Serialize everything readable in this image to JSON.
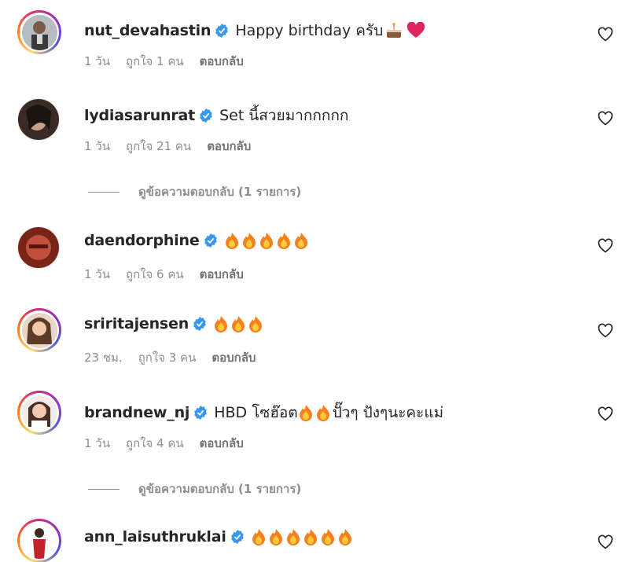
{
  "comments": [
    {
      "username": "nut_devahastin",
      "text": "Happy birthday ครับ",
      "emoji": [
        "cake",
        "heart"
      ],
      "time": "1 วัน",
      "likes": "ถูกใจ 1 คน",
      "reply": "ตอบกลับ"
    },
    {
      "username": "lydiasarunrat",
      "text": "Set นี้สวยมากกกกก",
      "emoji": [],
      "time": "1 วัน",
      "likes": "ถูกใจ 21 คน",
      "reply": "ตอบกลับ"
    },
    {
      "username": "daendorphine",
      "text": "",
      "emoji": [
        "fire",
        "fire",
        "fire",
        "fire",
        "fire"
      ],
      "time": "1 วัน",
      "likes": "ถูกใจ 6 คน",
      "reply": "ตอบกลับ"
    },
    {
      "username": "sriritajensen",
      "text": "",
      "emoji": [
        "fire",
        "fire",
        "fire"
      ],
      "time": "23 ชม.",
      "likes": "ถูกใจ 3 คน",
      "reply": "ตอบกลับ"
    },
    {
      "username": "brandnew_nj",
      "text": "HBD โซฮ๊อต",
      "text2": "ปั๊วๆ ปังๆนะคะแม่",
      "emoji": [
        "fire",
        "fire"
      ],
      "time": "1 วัน",
      "likes": "ถูกใจ 4 คน",
      "reply": "ตอบกลับ"
    },
    {
      "username": "ann_laisuthruklai",
      "text": "",
      "emoji": [
        "fire",
        "fire",
        "fire",
        "fire",
        "fire",
        "fire"
      ],
      "time": "",
      "likes": "",
      "reply": ""
    }
  ],
  "view_replies": [
    {
      "label": "ดูข้อความตอบกลับ (1 รายการ)"
    },
    {
      "label": "ดูข้อความตอบกลับ (1 รายการ)"
    }
  ],
  "icons": {
    "verified": "verified-badge-icon",
    "like": "heart-outline-icon"
  },
  "colors": {
    "verified": "#3897f0",
    "muted": "#8e8e8e",
    "text": "#262626"
  }
}
